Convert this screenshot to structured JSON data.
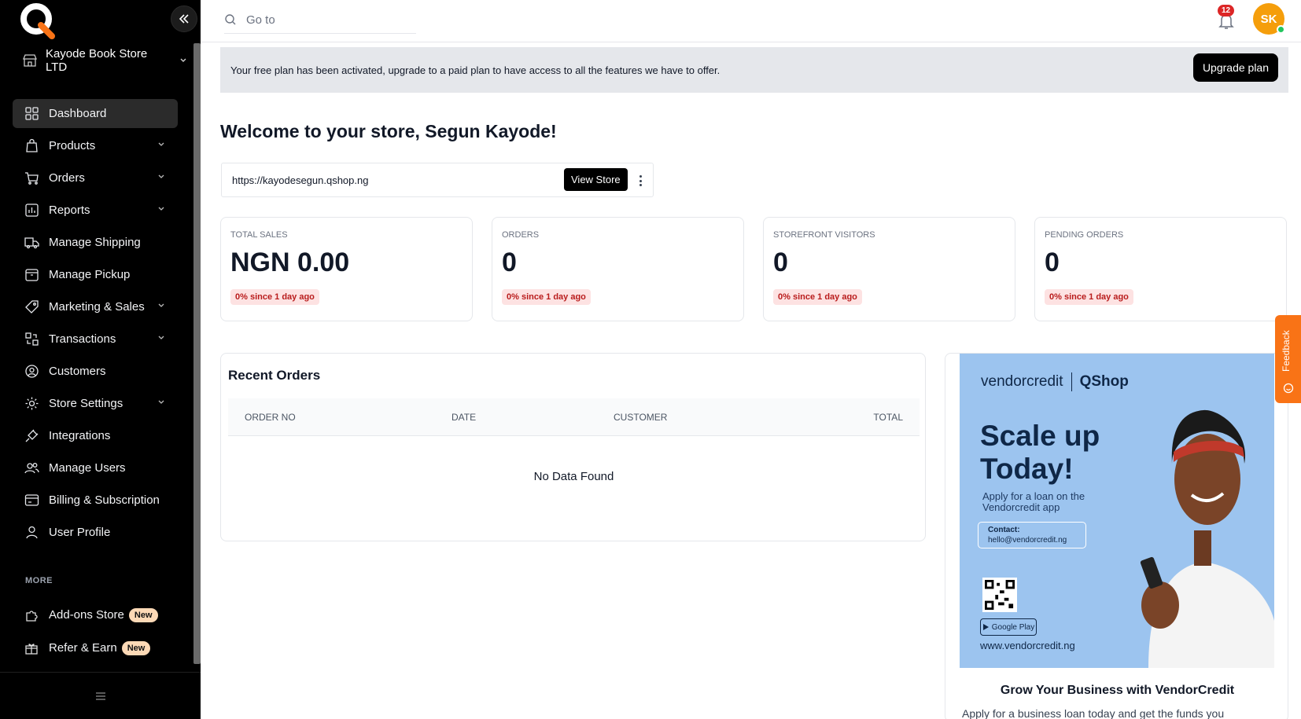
{
  "sidebar": {
    "store_name": "Kayode Book Store LTD",
    "nav": [
      {
        "label": "Dashboard",
        "icon": "dashboard-icon",
        "active": true,
        "has_chevron": false
      },
      {
        "label": "Products",
        "icon": "shopping-bag-icon",
        "has_chevron": true
      },
      {
        "label": "Orders",
        "icon": "cart-icon",
        "has_chevron": true
      },
      {
        "label": "Reports",
        "icon": "chart-icon",
        "has_chevron": true
      },
      {
        "label": "Manage Shipping",
        "icon": "truck-icon",
        "has_chevron": false
      },
      {
        "label": "Manage Pickup",
        "icon": "box-icon",
        "has_chevron": false
      },
      {
        "label": "Marketing & Sales",
        "icon": "tag-icon",
        "has_chevron": true
      },
      {
        "label": "Transactions",
        "icon": "transactions-icon",
        "has_chevron": true
      },
      {
        "label": "Customers",
        "icon": "customer-icon",
        "has_chevron": false
      },
      {
        "label": "Store Settings",
        "icon": "gear-icon",
        "has_chevron": true
      },
      {
        "label": "Integrations",
        "icon": "plug-icon",
        "has_chevron": false
      },
      {
        "label": "Manage Users",
        "icon": "users-icon",
        "has_chevron": false
      },
      {
        "label": "Billing & Subscription",
        "icon": "billing-icon",
        "has_chevron": false
      },
      {
        "label": "User Profile",
        "icon": "user-icon",
        "has_chevron": false
      }
    ],
    "more_label": "MORE",
    "extras": [
      {
        "label": "Add-ons Store",
        "badge": "New",
        "icon": "puzzle-icon"
      },
      {
        "label": "Refer & Earn",
        "badge": "New",
        "icon": "gift-icon"
      }
    ]
  },
  "topbar": {
    "search_placeholder": "Go to",
    "notification_count": "12",
    "avatar_initials": "SK"
  },
  "banner": {
    "text": "Your free plan has been activated, upgrade to a paid plan to have access to all the features we have to offer.",
    "button": "Upgrade plan"
  },
  "welcome": "Welcome to your store, Segun Kayode!",
  "store_url": {
    "url": "https://kayodesegun.qshop.ng",
    "button": "View Store"
  },
  "stats": [
    {
      "label": "TOTAL SALES",
      "value": "NGN 0.00",
      "delta": "0% since 1 day ago"
    },
    {
      "label": "ORDERS",
      "value": "0",
      "delta": "0% since 1 day ago"
    },
    {
      "label": "STOREFRONT VISITORS",
      "value": "0",
      "delta": "0% since 1 day ago"
    },
    {
      "label": "PENDING ORDERS",
      "value": "0",
      "delta": "0% since 1 day ago"
    }
  ],
  "recent_orders": {
    "title": "Recent Orders",
    "columns": [
      "ORDER NO",
      "DATE",
      "CUSTOMER",
      "TOTAL"
    ],
    "empty": "No Data Found"
  },
  "promo": {
    "brand_left": "vendorcredit",
    "brand_right": "QShop",
    "headline_1": "Scale up",
    "headline_2": "Today!",
    "sub": "Apply for a loan on the Vendorcredit app",
    "contact_label": "Contact:",
    "contact_email": "hello@vendorcredit.ng",
    "store_badge": "Google Play",
    "url": "www.vendorcredit.ng",
    "title": "Grow Your Business with VendorCredit",
    "text": "Apply for a business loan today and get the funds you"
  },
  "feedback_label": "Feedback",
  "colors": {
    "sidebar_bg": "#000000",
    "accent_orange": "#f97316",
    "avatar": "#f59e0b",
    "delta_bg": "#fde2e2",
    "delta_text": "#b91c1c",
    "promo_bg": "#9cc4ef"
  }
}
